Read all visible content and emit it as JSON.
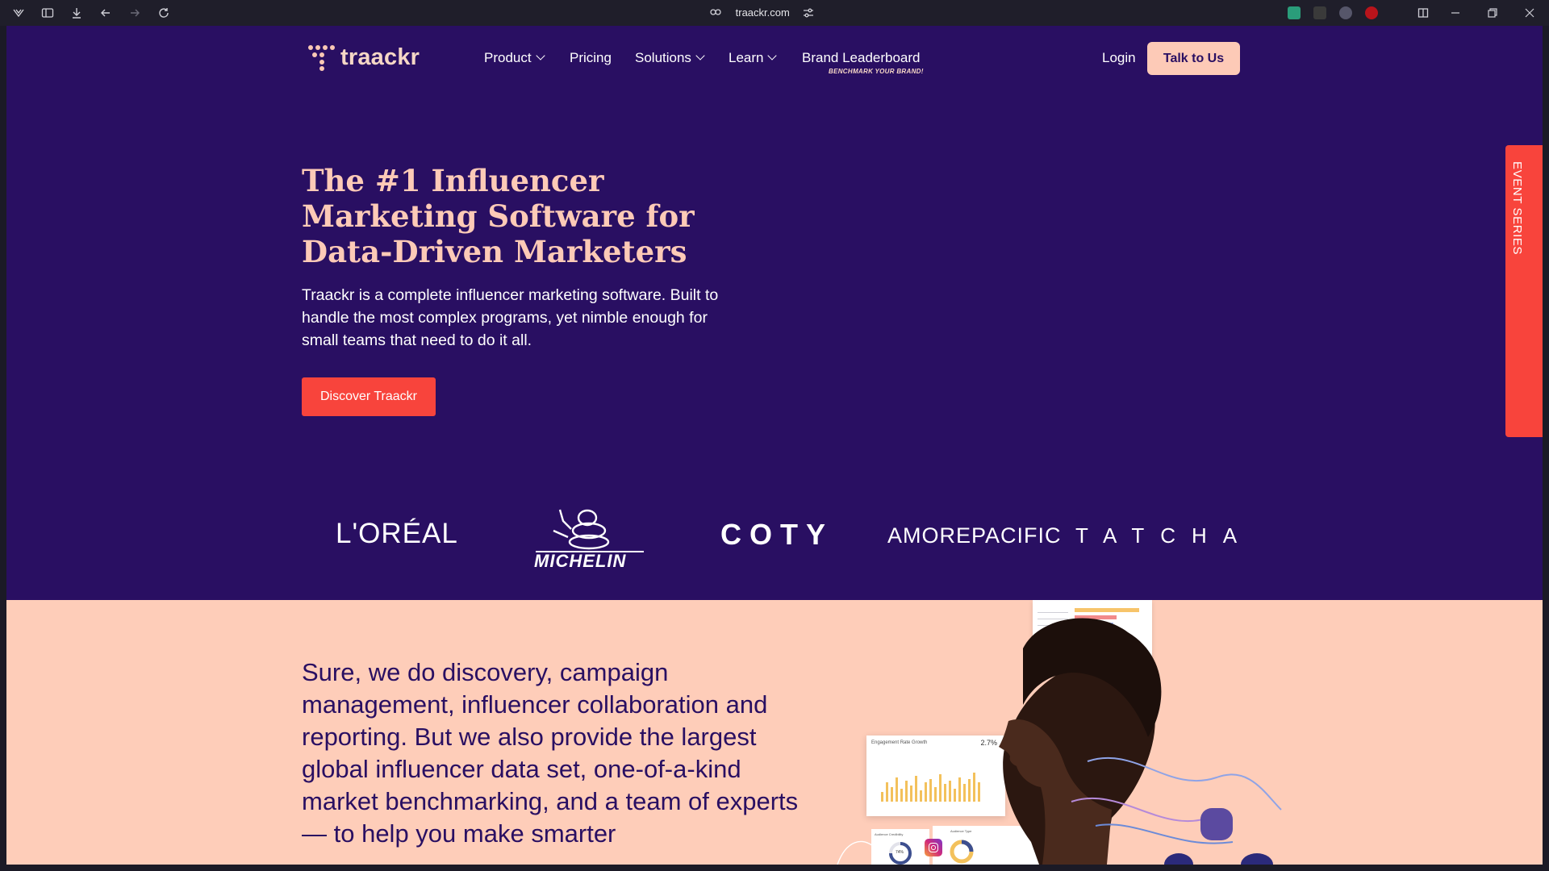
{
  "browser": {
    "url": "traackr.com"
  },
  "nav": {
    "logo_text": "traackr",
    "items": [
      {
        "label": "Product"
      },
      {
        "label": "Pricing"
      },
      {
        "label": "Solutions"
      },
      {
        "label": "Learn"
      },
      {
        "label": "Brand Leaderboard",
        "tag": "BENCHMARK YOUR BRAND!"
      }
    ],
    "login_label": "Login",
    "cta_label": "Talk to Us"
  },
  "hero": {
    "title": "The #1 Influencer Marketing Software for Data-Driven Marketers",
    "description": "Traackr is a complete influencer marketing software. Built to handle the most complex programs, yet nimble enough for small teams that need to do it all.",
    "button_label": "Discover Traackr"
  },
  "event_tab": {
    "label": "EVENT SERIES"
  },
  "brands": {
    "loreal": "L'ORÉAL",
    "michelin": "MICHELIN",
    "coty": "COTY",
    "amorepacific": "AMOREPACIFIC",
    "tatcha": "TATCHA"
  },
  "section2": {
    "text": "Sure, we do discovery, campaign management, influencer collaboration and reporting. But we also provide the largest global influencer data set, one-of-a-kind market benchmarking, and a team of experts — to help you make smarter",
    "chart_card_title": "Engagement Rate Growth",
    "chart_card_value": "2.7%",
    "donut_label": "74%",
    "card_audience_title": "Audience Type",
    "card_credibility_title": "Audience Credibility"
  },
  "colors": {
    "brand_purple": "#290f62",
    "peach": "#fecdb9",
    "accent_red": "#f8443c",
    "title_peach": "#fdcab7"
  }
}
